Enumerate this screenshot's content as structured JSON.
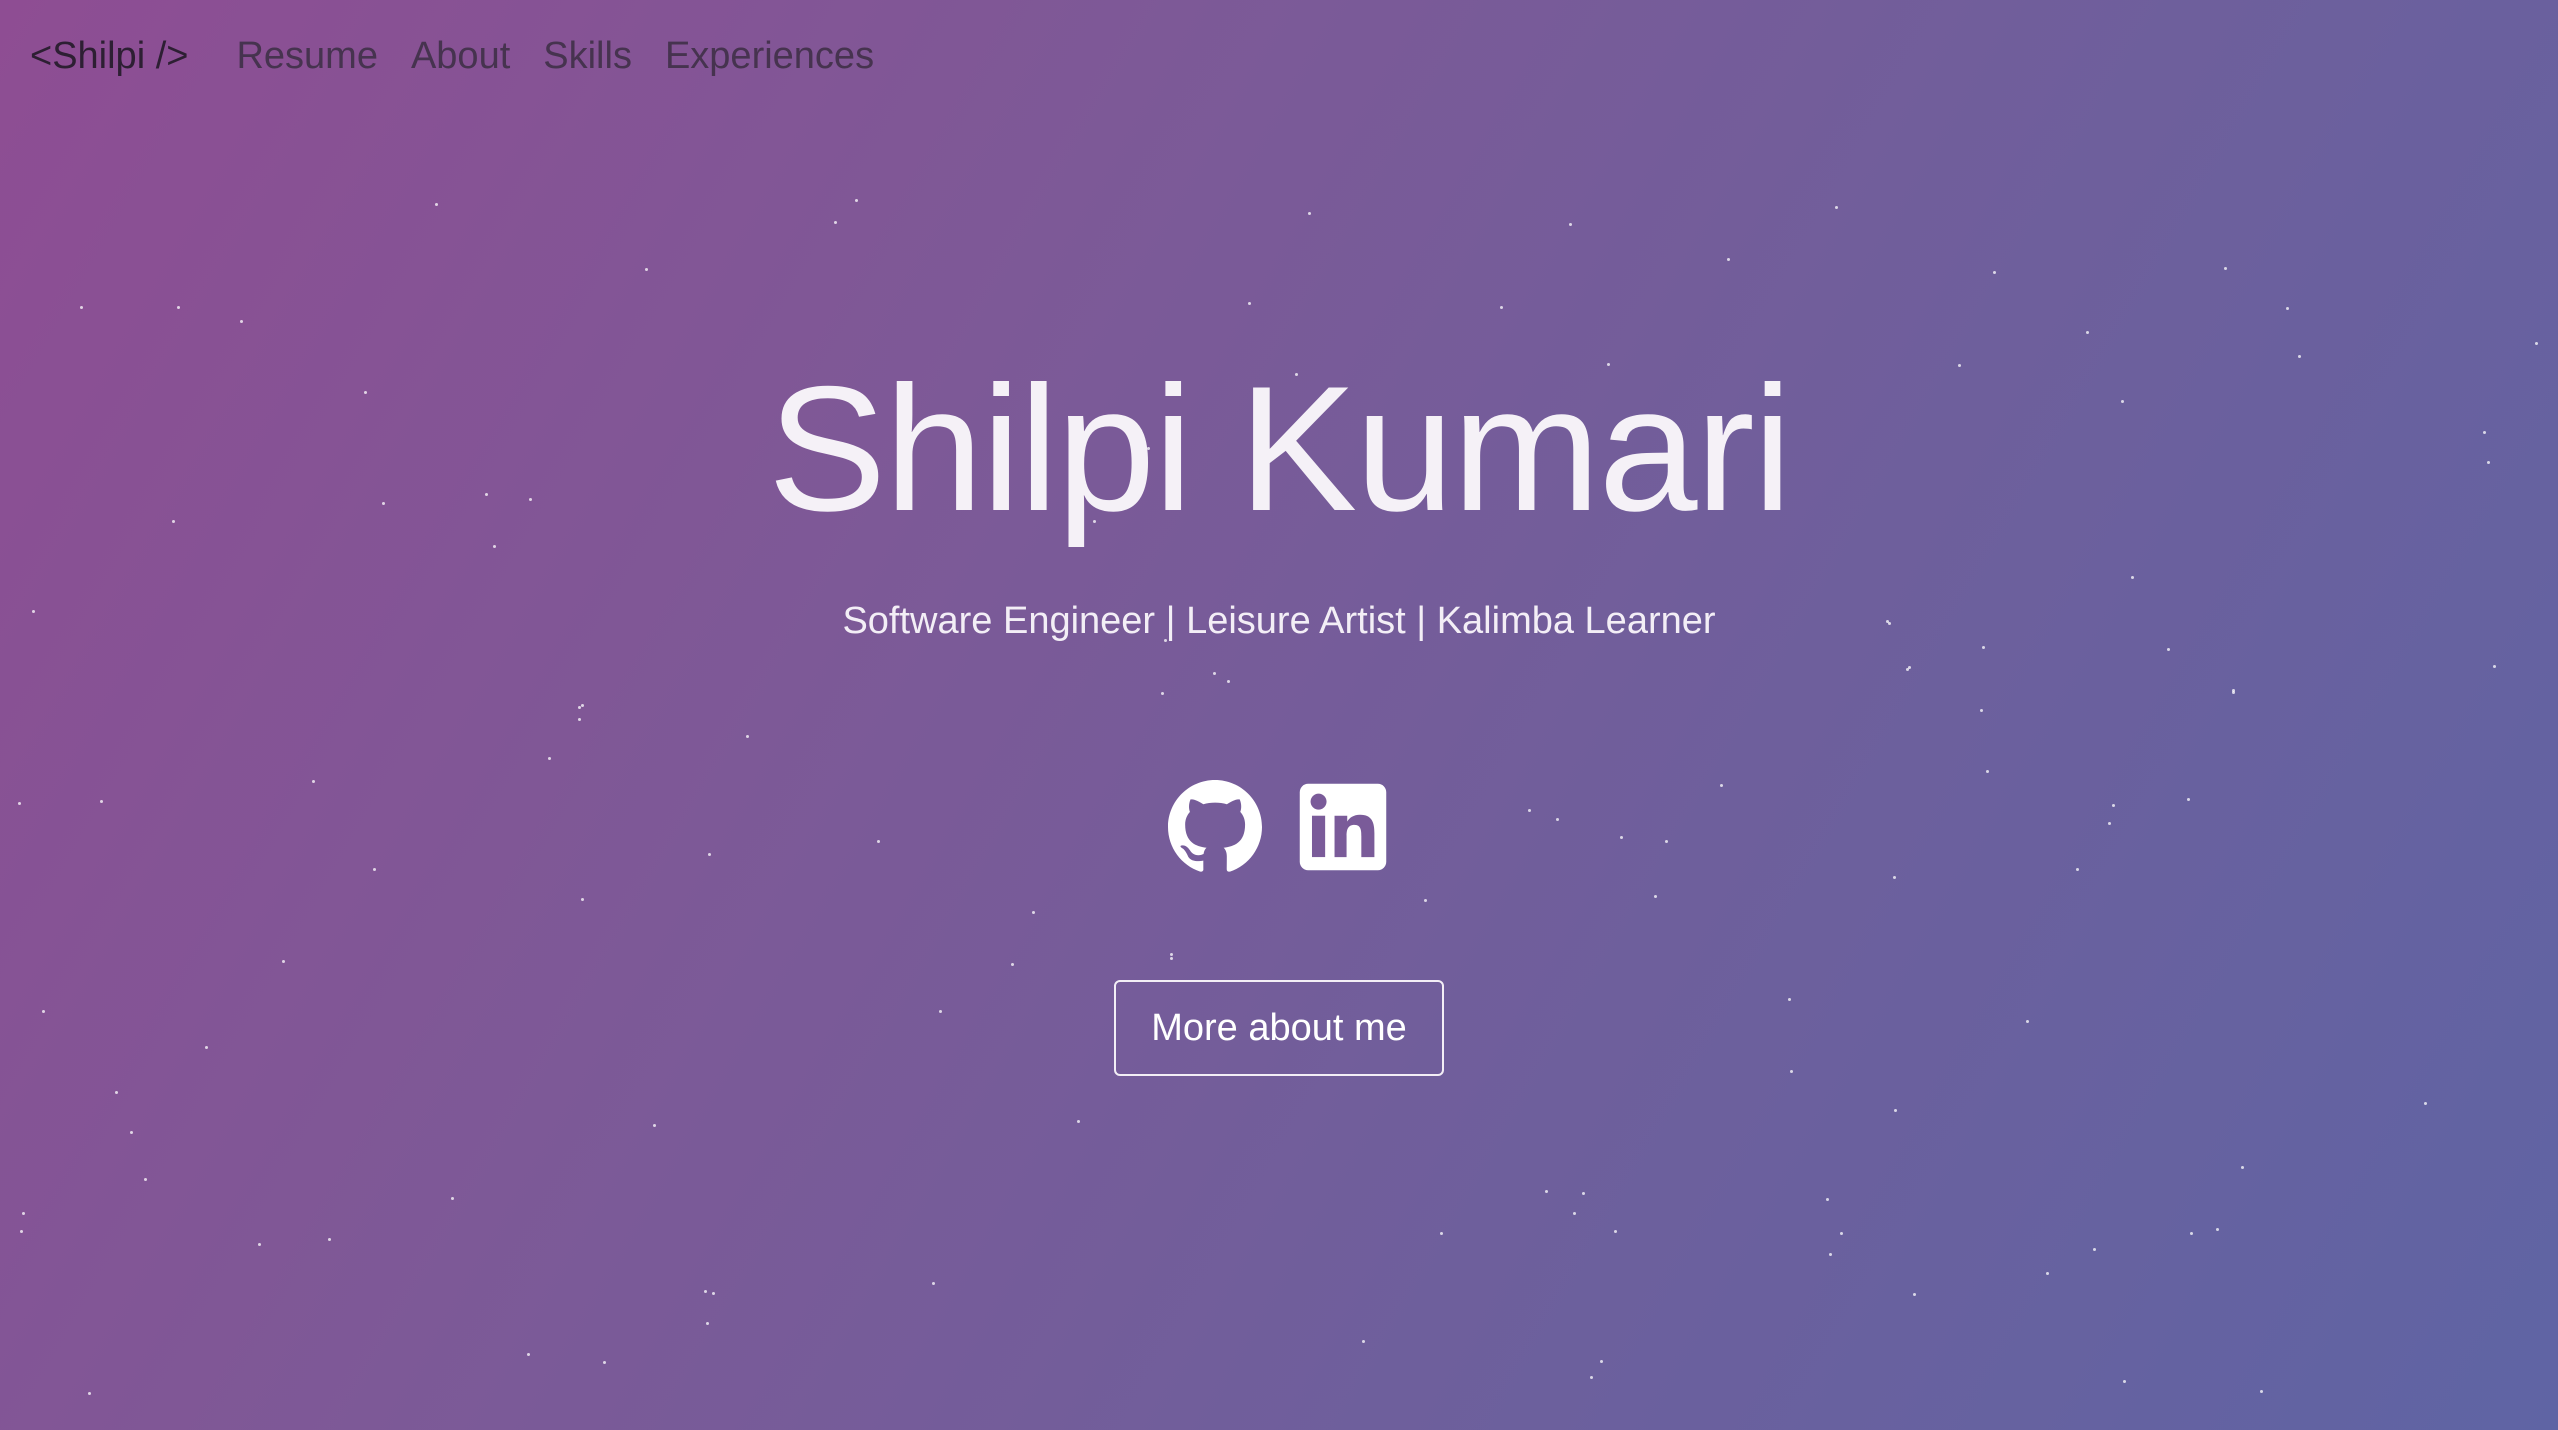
{
  "nav": {
    "brand": "<Shilpi />",
    "links": [
      "Resume",
      "About",
      "Skills",
      "Experiences"
    ]
  },
  "hero": {
    "name": "Shilpi Kumari",
    "tagline": "Software Engineer | Leisure Artist | Kalimba Learner",
    "social_icons": [
      "github-icon",
      "linkedin-icon"
    ],
    "cta_label": "More about me"
  },
  "colors": {
    "gradient_start": "#8e4d93",
    "gradient_end": "#5f64a4",
    "nav_text": "#46334f",
    "hero_text": "#f5f1f7"
  }
}
